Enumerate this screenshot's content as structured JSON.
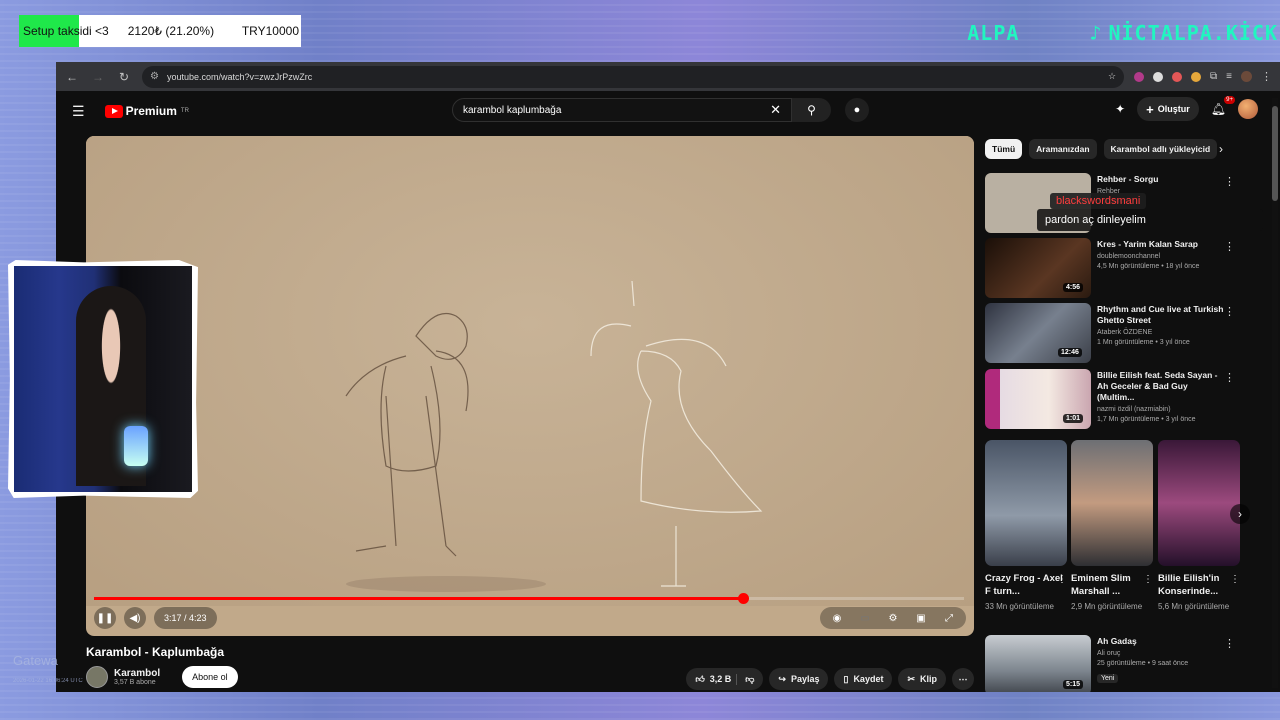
{
  "overlay": {
    "donation": {
      "text": "Setup taksidi <3",
      "amount": "2120₺ (21.20%)",
      "goal": "TRY10000",
      "progress": 0.212
    },
    "brand_left": "ALPA",
    "brand_handle": "NİCTALPA.KİCK",
    "chat_pickup": {
      "user": "blackswordsmani",
      "message": "pardon aç dinleyelim"
    },
    "watermark": "Gatewa",
    "watermark_small": "2026-01-22 16:06:24 UTC"
  },
  "browser": {
    "url": "youtube.com/watch?v=zwzJrPzwZrc"
  },
  "youtube": {
    "logo_text": "Premium",
    "logo_region": "TR",
    "search_value": "karambol kaplumbağa",
    "create_label": "Oluştur",
    "notif_badge": "9+"
  },
  "player": {
    "time": "3:17 / 4:23",
    "progress": 0.7464
  },
  "video": {
    "title": "Karambol - Kaplumbağa",
    "channel": "Karambol",
    "subscribers": "3,57 B abone",
    "subscribe_label": "Abone ol",
    "likes": "3,2 B",
    "share_label": "Paylaş",
    "save_label": "Kaydet",
    "clip_label": "Klip"
  },
  "chips": [
    "Tümü",
    "Aramanızdan",
    "Karambol adlı yükleyicid"
  ],
  "related": [
    {
      "title": "Rehber - Sorgu",
      "channel": "Rehber",
      "meta": "5 yıl önce",
      "duration": "",
      "color": "#b9b0a2"
    },
    {
      "title": "Kres - Yarim Kalan Sarap",
      "channel": "doublemoonchannel",
      "meta": "4,5 Mn görüntüleme • 18 yıl önce",
      "duration": "4:56",
      "color": "#3a2418"
    },
    {
      "title": "Rhythm and Cue live at Turkish Ghetto Street",
      "channel": "Ataberk ÖZDENE",
      "meta": "1 Mn görüntüleme • 3 yıl önce",
      "duration": "12:46",
      "color": "#555a66"
    },
    {
      "title": "Billie Eilish feat. Seda Sayan - Ah Geceler & Bad Guy (Multim...",
      "channel": "nazmi özdil (nazmiabin)",
      "meta": "1,7 Mn görüntüleme • 3 yıl önce",
      "duration": "1:01",
      "color": "#d8c8d8"
    },
    {
      "title": "Ah Gadaş",
      "channel": "Ali oruç",
      "meta": "25 görüntüleme • 9 saat önce",
      "duration": "5:15",
      "color": "#9aa0a6",
      "badge": "Yeni"
    }
  ],
  "shorts": [
    {
      "title": "Crazy Frog - Axel F turn...",
      "views": "33 Mn görüntüleme",
      "color": "#6f7c90"
    },
    {
      "title": "Eminem Slim Marshall ...",
      "views": "2,9 Mn görüntüleme",
      "color": "#b89a83"
    },
    {
      "title": "Billie Eilish'in Konserinde...",
      "views": "5,6 Mn görüntüleme",
      "color": "#7a3c6a"
    }
  ]
}
